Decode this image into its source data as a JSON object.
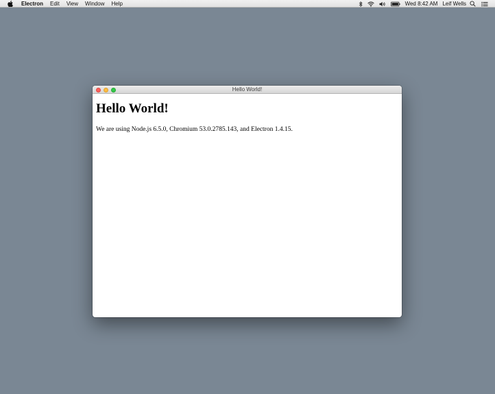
{
  "menubar": {
    "apple_icon": "apple-logo-icon",
    "items": [
      {
        "label": "Electron",
        "bold": true
      },
      {
        "label": "Edit"
      },
      {
        "label": "View"
      },
      {
        "label": "Window"
      },
      {
        "label": "Help"
      }
    ],
    "status": {
      "icons": [
        "bluetooth-icon",
        "wifi-icon",
        "volume-icon",
        "battery-icon"
      ],
      "clock": "Wed 8:42 AM",
      "user": "Leif Wells",
      "right_icons": [
        "spotlight-search-icon",
        "notification-center-icon"
      ]
    }
  },
  "window": {
    "title": "Hello World!",
    "heading": "Hello World!",
    "body_text": "We are using Node.js 6.5.0, Chromium 53.0.2785.143, and Electron 1.4.15."
  },
  "colors": {
    "desktop": "#7a8794",
    "close": "#fc605c",
    "minimize": "#fdbc40",
    "zoom": "#34c84a"
  }
}
